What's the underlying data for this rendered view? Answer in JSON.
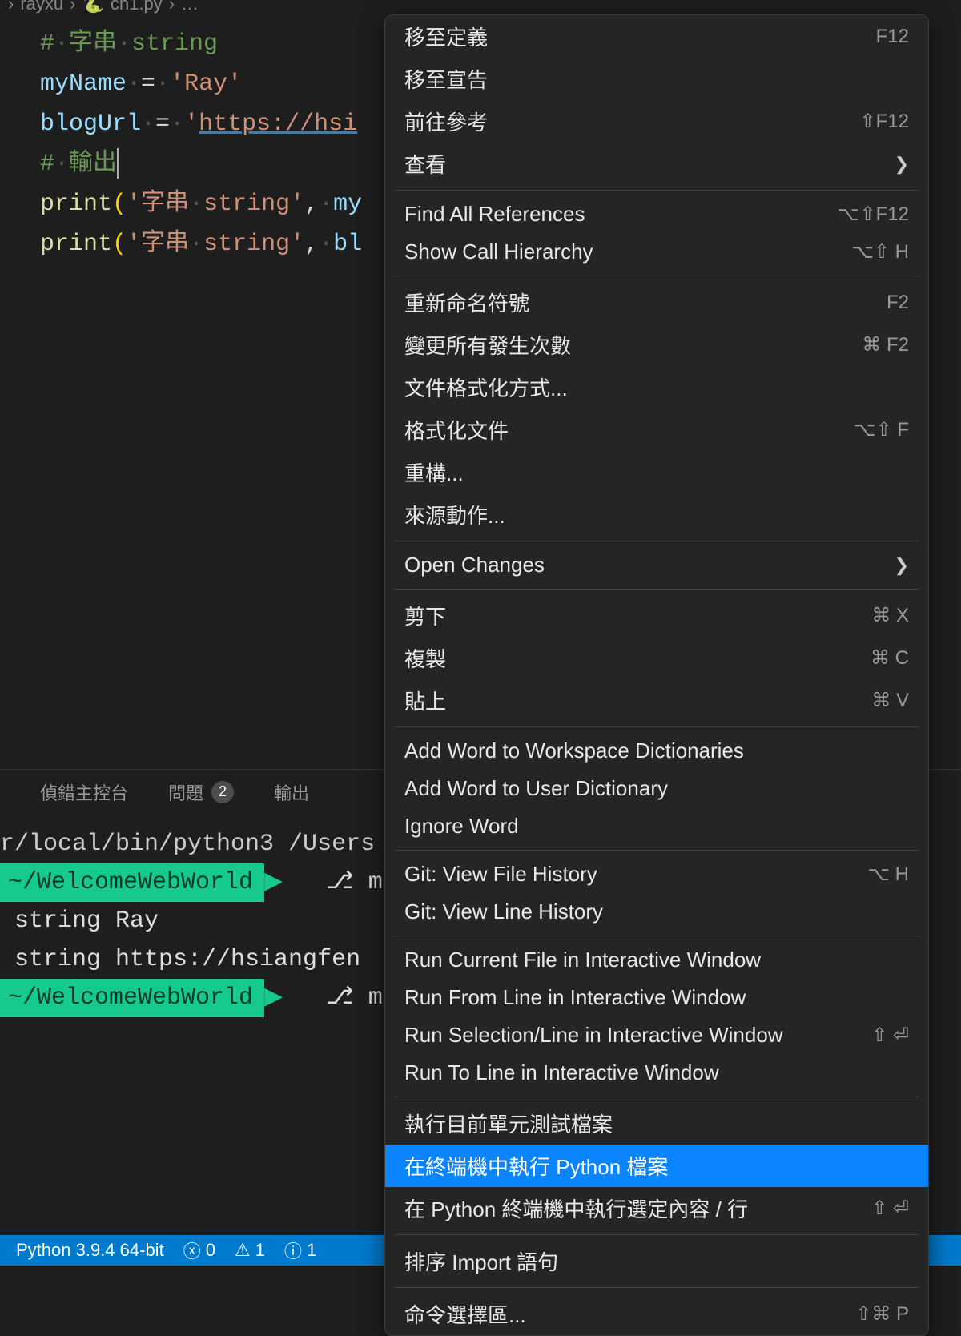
{
  "breadcrumb": {
    "folder": "rayxu",
    "file": "ch1.py",
    "more": "…"
  },
  "code": {
    "l1": {
      "c1": "#",
      "c2": "字串",
      "c3": "string"
    },
    "l2": {
      "v": "myName",
      "eq": "=",
      "s": "'Ray'"
    },
    "l3": {
      "v": "blogUrl",
      "eq": "=",
      "s1": "'",
      "s2": "https://hsi"
    },
    "l4": {
      "c1": "#",
      "c2": "輸出"
    },
    "l5": {
      "f": "print",
      "p1": "(",
      "s": "'字串",
      "s2": "string'",
      "comma": ",",
      "v": "my"
    },
    "l6": {
      "f": "print",
      "p1": "(",
      "s": "'字串",
      "s2": "string'",
      "comma": ",",
      "v": "bl"
    }
  },
  "panel": {
    "tab1": "偵錯主控台",
    "tab2": "問題",
    "badge": "2",
    "tab3": "輸出"
  },
  "terminal": {
    "l1": "r/local/bin/python3 /Users",
    "prompt": "~/WelcomeWebWorld",
    "branch": "m",
    "out1": " string Ray",
    "out2": " string https://hsiangfen"
  },
  "statusbar": {
    "python": "Python 3.9.4 64-bit",
    "err": "0",
    "warn": "1",
    "info": "1"
  },
  "menu": {
    "g1": [
      {
        "label": "移至定義",
        "shortcut": "F12"
      },
      {
        "label": "移至宣告",
        "shortcut": ""
      },
      {
        "label": "前往參考",
        "shortcut": "⇧F12"
      },
      {
        "label": "查看",
        "submenu": true
      }
    ],
    "g2": [
      {
        "label": "Find All References",
        "shortcut": "⌥⇧F12"
      },
      {
        "label": "Show Call Hierarchy",
        "shortcut": "⌥⇧ H"
      }
    ],
    "g3": [
      {
        "label": "重新命名符號",
        "shortcut": "F2"
      },
      {
        "label": "變更所有發生次數",
        "shortcut": "⌘ F2"
      },
      {
        "label": "文件格式化方式...",
        "shortcut": ""
      },
      {
        "label": "格式化文件",
        "shortcut": "⌥⇧ F"
      },
      {
        "label": "重構...",
        "shortcut": ""
      },
      {
        "label": "來源動作...",
        "shortcut": ""
      }
    ],
    "g4": [
      {
        "label": "Open Changes",
        "submenu": true
      }
    ],
    "g5": [
      {
        "label": "剪下",
        "shortcut": "⌘ X"
      },
      {
        "label": "複製",
        "shortcut": "⌘ C"
      },
      {
        "label": "貼上",
        "shortcut": "⌘ V"
      }
    ],
    "g6": [
      {
        "label": "Add Word to Workspace Dictionaries",
        "shortcut": ""
      },
      {
        "label": "Add Word to User Dictionary",
        "shortcut": ""
      },
      {
        "label": "Ignore Word",
        "shortcut": ""
      }
    ],
    "g7": [
      {
        "label": "Git: View File History",
        "shortcut": "⌥ H"
      },
      {
        "label": "Git: View Line History",
        "shortcut": ""
      }
    ],
    "g8": [
      {
        "label": "Run Current File in Interactive Window",
        "shortcut": ""
      },
      {
        "label": "Run From Line in Interactive Window",
        "shortcut": ""
      },
      {
        "label": "Run Selection/Line in Interactive Window",
        "shortcut": "⇧ ⏎"
      },
      {
        "label": "Run To Line in Interactive Window",
        "shortcut": ""
      }
    ],
    "g9": [
      {
        "label": "執行目前單元測試檔案",
        "shortcut": ""
      },
      {
        "label": "在終端機中執行 Python 檔案",
        "shortcut": "",
        "selected": true
      },
      {
        "label": "在 Python 終端機中執行選定內容 / 行",
        "shortcut": "⇧ ⏎"
      }
    ],
    "g10": [
      {
        "label": "排序 Import 語句",
        "shortcut": ""
      }
    ],
    "g11": [
      {
        "label": "命令選擇區...",
        "shortcut": "⇧⌘ P"
      }
    ]
  }
}
